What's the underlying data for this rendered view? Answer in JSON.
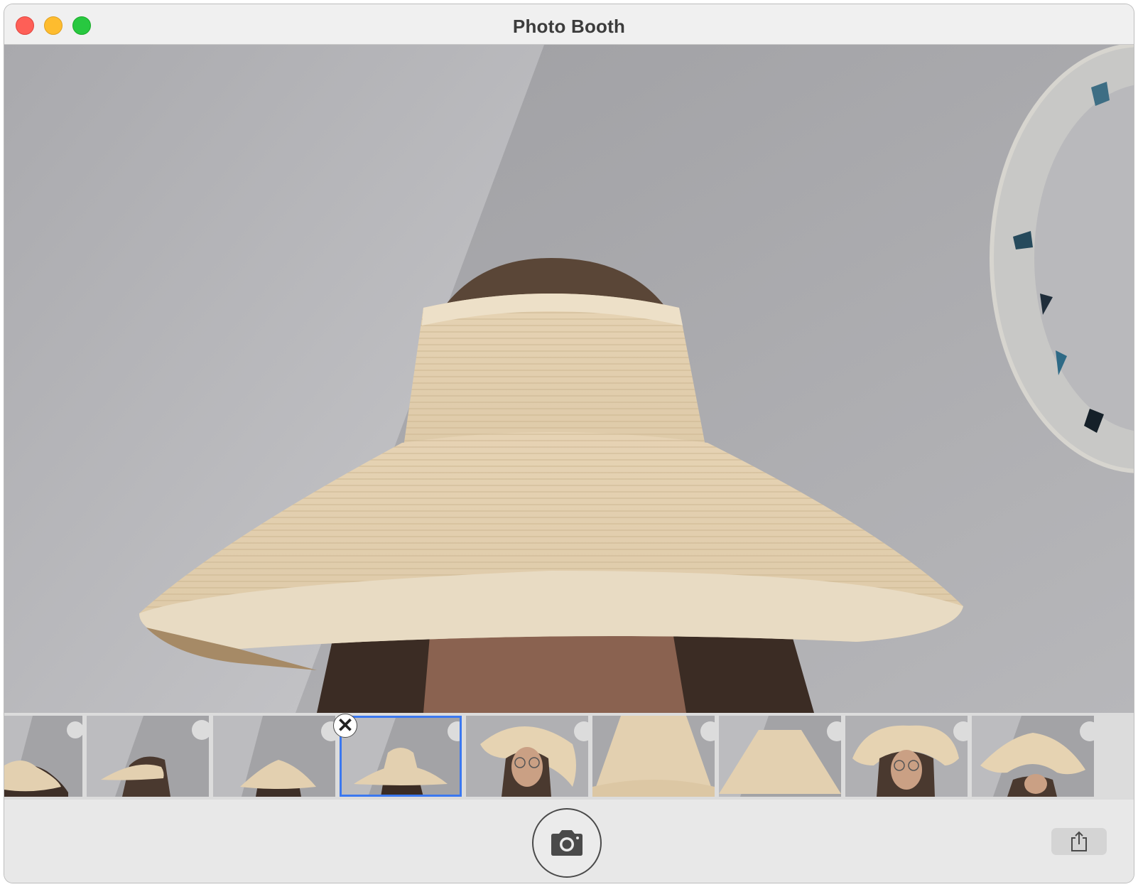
{
  "window": {
    "title": "Photo Booth"
  },
  "traffic_lights": {
    "close": "close-button",
    "minimize": "minimize-button",
    "zoom": "zoom-button"
  },
  "colors": {
    "selection": "#3b78f0",
    "close_light": "#fe5f57",
    "min_light": "#febc2e",
    "max_light": "#28c840"
  },
  "thumbnails": [
    {
      "name": "photo-1",
      "selected": false
    },
    {
      "name": "photo-2",
      "selected": false
    },
    {
      "name": "photo-3",
      "selected": false
    },
    {
      "name": "photo-4",
      "selected": true
    },
    {
      "name": "photo-5",
      "selected": false
    },
    {
      "name": "photo-6",
      "selected": false
    },
    {
      "name": "photo-7",
      "selected": false
    },
    {
      "name": "photo-8",
      "selected": false
    },
    {
      "name": "photo-9",
      "selected": false
    }
  ],
  "toolbar": {
    "shutter_icon": "camera-icon",
    "share_icon": "share-icon",
    "delete_icon": "close-icon"
  }
}
